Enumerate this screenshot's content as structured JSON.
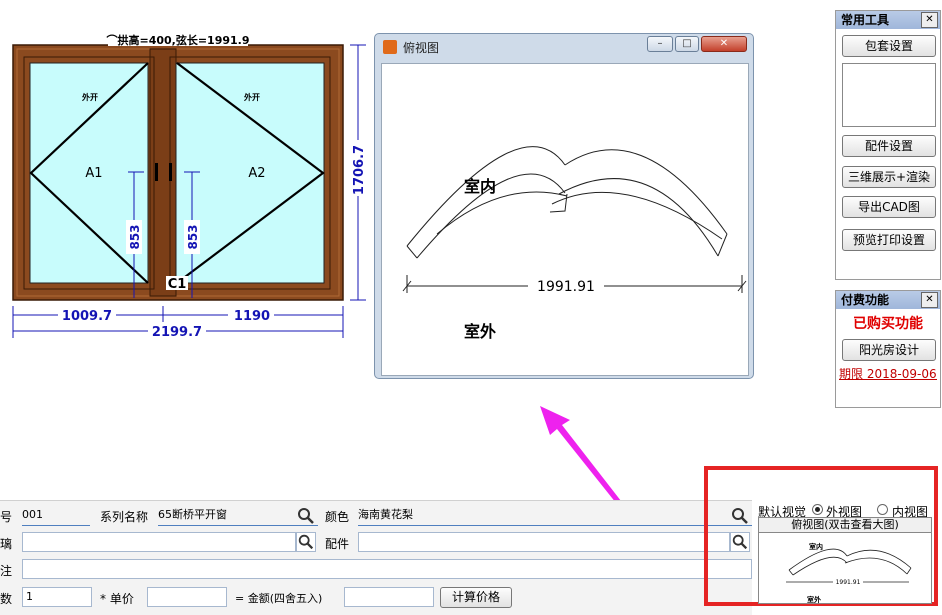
{
  "window_drawing": {
    "arc_caption": "⌒拱高=400,弦长=1991.9",
    "sash_left": {
      "label": "A1",
      "open_dir": "外开",
      "handle_dim": "853"
    },
    "sash_right": {
      "label": "A2",
      "open_dir": "外开",
      "handle_dim": "853"
    },
    "mullion_label": "C1",
    "dim_height": "1706.7",
    "dim_left": "1009.7",
    "dim_right": "1190",
    "dim_total": "2199.7",
    "colors": {
      "frame": "#8b4a1f",
      "glass": "#c8fcfc",
      "dimension": "#1414b4"
    }
  },
  "top_view_window": {
    "title": "俯视图",
    "indoor": "室内",
    "outdoor": "室外",
    "chord": "1991.91",
    "buttons": {
      "minimize": "–",
      "maximize": "□",
      "close": "✕"
    }
  },
  "tools_panel": {
    "title": "常用工具",
    "close": "✕",
    "buttons": [
      "包套设置",
      "配件设置",
      "三维展示+渲染",
      "导出CAD图",
      "预览打印设置"
    ]
  },
  "paid_panel": {
    "title": "付费功能",
    "close": "✕",
    "purchased": "已购买功能",
    "sunroom_button": "阳光房设计",
    "expiry_label": "期限",
    "expiry_date": "2018-09-06",
    "accent": "#e00000"
  },
  "form": {
    "number_label": "号",
    "number_value": "001",
    "series_label": "系列名称",
    "series_value": "65断桥平开窗",
    "color_label": "颜色",
    "color_value": "海南黄花梨",
    "glass_label": "璃",
    "glass_value": "",
    "fittings_label": "配件",
    "fittings_value": "",
    "note_label": "注",
    "note_value": "",
    "qty_label": "数",
    "qty_value": "1",
    "unit_price_label": "* 单价",
    "unit_price_value": "",
    "amount_label": "= 金额(四舍五入)",
    "amount_value": "",
    "calc_button": "计算价格"
  },
  "default_view": {
    "label": "默认视觉",
    "option_outer": "外视图",
    "option_inner": "内视图",
    "selected": "外视图",
    "thumb_title": "俯视图(双击查看大图)",
    "thumb_indoor": "室内",
    "thumb_outdoor": "室外",
    "thumb_chord": "1991.91",
    "highlight": "#e52424"
  },
  "annotation": {
    "arrow_color": "#ee22ee"
  }
}
